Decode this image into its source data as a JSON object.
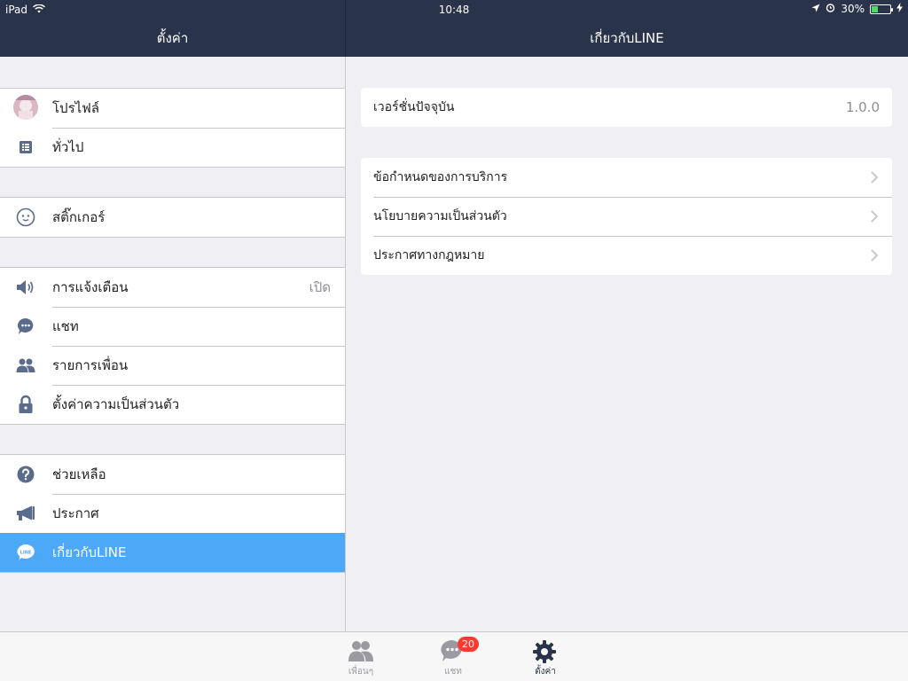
{
  "status_bar": {
    "device": "iPad",
    "time": "10:48",
    "battery": "30%",
    "battery_level": 0.3
  },
  "nav": {
    "left_title": "ตั้งค่า",
    "right_title": "เกี่ยวกับLINE"
  },
  "sidebar": {
    "groups": [
      [
        {
          "label": "โปรไฟล์",
          "icon": "profile-avatar"
        },
        {
          "label": "ทั่วไป",
          "icon": "list-icon"
        }
      ],
      [
        {
          "label": "สติ๊กเกอร์",
          "icon": "sticker-icon"
        }
      ],
      [
        {
          "label": "การแจ้งเตือน",
          "icon": "speaker-icon",
          "value": "เปิด"
        },
        {
          "label": "แชท",
          "icon": "chat-bubble-icon"
        },
        {
          "label": "รายการเพื่อน",
          "icon": "friends-icon"
        },
        {
          "label": "ตั้งค่าความเป็นส่วนตัว",
          "icon": "lock-icon"
        }
      ],
      [
        {
          "label": "ช่วยเหลือ",
          "icon": "help-icon"
        },
        {
          "label": "ประกาศ",
          "icon": "megaphone-icon"
        },
        {
          "label": "เกี่ยวกับLINE",
          "icon": "line-logo-icon",
          "active": true
        }
      ]
    ]
  },
  "about": {
    "version_label": "เวอร์ชั่นปัจจุบัน",
    "version_value": "1.0.0",
    "links": [
      {
        "label": "ข้อกำหนดของการบริการ"
      },
      {
        "label": "นโยบายความเป็นส่วนตัว"
      },
      {
        "label": "ประกาศทางกฎหมาย"
      }
    ]
  },
  "tabbar": {
    "tabs": [
      {
        "label": "เพื่อนๆ",
        "icon": "friends-tab-icon"
      },
      {
        "label": "แชท",
        "icon": "chat-tab-icon",
        "badge": "20"
      },
      {
        "label": "ตั้งค่า",
        "icon": "gear-icon",
        "active": true
      }
    ]
  },
  "colors": {
    "nav_bg": "#29344b",
    "active_row": "#4ea8f8",
    "badge": "#ff3b30",
    "icon": "#5a6b8c"
  }
}
